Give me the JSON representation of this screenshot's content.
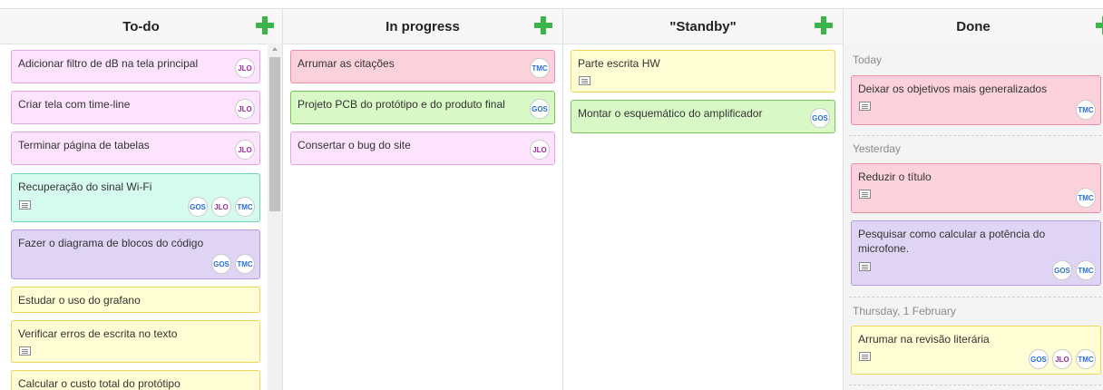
{
  "columns": [
    {
      "title": "To-do",
      "add_label": "+"
    },
    {
      "title": "In progress",
      "add_label": "+"
    },
    {
      "title": "\"Standby\"",
      "add_label": "+"
    },
    {
      "title": "Done",
      "add_label": "+"
    }
  ],
  "todo": [
    {
      "title": "Adicionar filtro de dB na tela principal",
      "avatars": [
        "JLO"
      ]
    },
    {
      "title": "Criar tela com time-line",
      "avatars": [
        "JLO"
      ]
    },
    {
      "title": "Terminar página de tabelas",
      "avatars": [
        "JLO"
      ]
    },
    {
      "title": "Recuperação do sinal Wi-Fi",
      "avatars": [
        "GOS",
        "JLO",
        "TMC"
      ]
    },
    {
      "title": "Fazer o diagrama de blocos do código",
      "avatars": [
        "GOS",
        "TMC"
      ]
    },
    {
      "title": "Estudar o uso do grafano",
      "avatars": []
    },
    {
      "title": "Verificar erros de escrita no texto",
      "avatars": []
    },
    {
      "title": "Calcular o custo total do protótipo",
      "avatars": []
    }
  ],
  "inprogress": [
    {
      "title": "Arrumar as citações",
      "avatars": [
        "TMC"
      ]
    },
    {
      "title": "Projeto PCB do protótipo e do produto final",
      "avatars": [
        "GOS"
      ]
    },
    {
      "title": "Consertar o bug do site",
      "avatars": [
        "JLO"
      ]
    }
  ],
  "standby": [
    {
      "title": "Parte escrita HW",
      "avatars": []
    },
    {
      "title": "Montar o esquemático do amplificador",
      "avatars": [
        "GOS"
      ]
    }
  ],
  "done": {
    "groups": [
      {
        "label": "Today",
        "cards": [
          {
            "title": "Deixar os objetivos mais generalizados",
            "avatars": [
              "TMC"
            ]
          }
        ]
      },
      {
        "label": "Yesterday",
        "cards": [
          {
            "title": "Reduzir o título",
            "avatars": [
              "TMC"
            ]
          },
          {
            "title": "Pesquisar como calcular a potência do microfone.",
            "avatars": [
              "GOS",
              "TMC"
            ]
          }
        ]
      },
      {
        "label": "Thursday, 1 February",
        "cards": [
          {
            "title": "Arrumar na revisão literária",
            "avatars": [
              "GOS",
              "JLO",
              "TMC"
            ]
          }
        ]
      }
    ]
  },
  "colors": {
    "add": "#39b54a",
    "pink": "#fde3fd",
    "red": "#fbd2dc",
    "green": "#d8f9c6",
    "mint": "#d5fbef",
    "purple": "#e0d4f4",
    "yellow": "#fffdd4"
  }
}
